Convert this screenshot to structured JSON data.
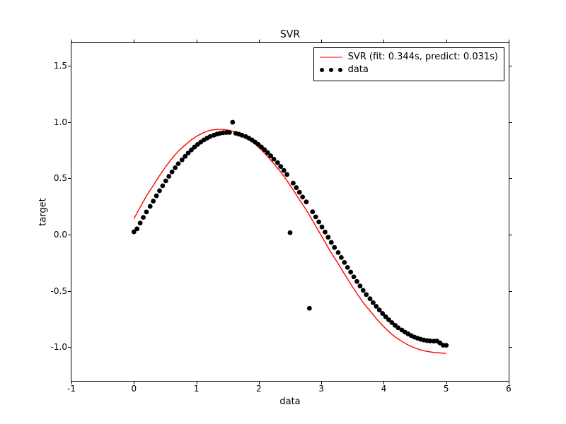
{
  "chart_data": {
    "type": "scatter",
    "title": "SVR",
    "xlabel": "data",
    "ylabel": "target",
    "xlim": [
      -1,
      6
    ],
    "ylim": [
      -1.3,
      1.7
    ],
    "xticks": [
      -1,
      0,
      1,
      2,
      3,
      4,
      5,
      6
    ],
    "yticks": [
      -1.0,
      -0.5,
      0.0,
      0.5,
      1.0,
      1.5
    ],
    "series": [
      {
        "name": "SVR (fit: 0.344s, predict: 0.031s)",
        "type": "line",
        "color": "#ff0000",
        "x": [
          0.0,
          0.1,
          0.2,
          0.31,
          0.41,
          0.51,
          0.61,
          0.71,
          0.82,
          0.92,
          1.02,
          1.12,
          1.22,
          1.33,
          1.43,
          1.53,
          1.63,
          1.73,
          1.84,
          1.94,
          2.04,
          2.14,
          2.24,
          2.35,
          2.45,
          2.55,
          2.65,
          2.76,
          2.86,
          2.96,
          3.06,
          3.16,
          3.27,
          3.37,
          3.47,
          3.57,
          3.67,
          3.78,
          3.88,
          3.98,
          4.08,
          4.18,
          4.29,
          4.39,
          4.49,
          4.59,
          4.69,
          4.8,
          4.9,
          5.0
        ],
        "y": [
          0.141,
          0.243,
          0.342,
          0.436,
          0.523,
          0.604,
          0.676,
          0.74,
          0.795,
          0.841,
          0.878,
          0.906,
          0.925,
          0.934,
          0.934,
          0.925,
          0.907,
          0.881,
          0.846,
          0.803,
          0.752,
          0.693,
          0.628,
          0.556,
          0.479,
          0.396,
          0.309,
          0.218,
          0.124,
          0.028,
          -0.068,
          -0.164,
          -0.258,
          -0.35,
          -0.439,
          -0.524,
          -0.604,
          -0.678,
          -0.746,
          -0.808,
          -0.862,
          -0.909,
          -0.949,
          -0.981,
          -1.006,
          -1.025,
          -1.038,
          -1.047,
          -1.052,
          -1.055
        ]
      },
      {
        "name": "data",
        "type": "scatter",
        "color": "#000000",
        "x": [
          0.0,
          0.05,
          0.1,
          0.15,
          0.2,
          0.26,
          0.31,
          0.36,
          0.41,
          0.46,
          0.51,
          0.56,
          0.61,
          0.66,
          0.71,
          0.77,
          0.82,
          0.87,
          0.92,
          0.97,
          1.02,
          1.07,
          1.12,
          1.17,
          1.22,
          1.28,
          1.33,
          1.38,
          1.43,
          1.48,
          1.53,
          1.58,
          1.63,
          1.68,
          1.73,
          1.79,
          1.84,
          1.89,
          1.94,
          1.99,
          2.04,
          2.09,
          2.14,
          2.19,
          2.24,
          2.3,
          2.35,
          2.4,
          2.45,
          2.5,
          2.55,
          2.6,
          2.65,
          2.7,
          2.76,
          2.81,
          2.86,
          2.91,
          2.96,
          3.01,
          3.06,
          3.11,
          3.16,
          3.21,
          3.27,
          3.32,
          3.37,
          3.42,
          3.47,
          3.52,
          3.57,
          3.62,
          3.67,
          3.72,
          3.78,
          3.83,
          3.88,
          3.93,
          3.98,
          4.03,
          4.08,
          4.13,
          4.18,
          4.23,
          4.29,
          4.34,
          4.39,
          4.44,
          4.49,
          4.54,
          4.59,
          4.64,
          4.69,
          4.74,
          4.8,
          4.85,
          4.9,
          4.95,
          5.0
        ],
        "y": [
          0.024,
          0.051,
          0.102,
          0.152,
          0.201,
          0.25,
          0.297,
          0.344,
          0.389,
          0.433,
          0.476,
          0.517,
          0.556,
          0.593,
          0.629,
          0.663,
          0.694,
          0.724,
          0.751,
          0.777,
          0.8,
          0.821,
          0.84,
          0.856,
          0.87,
          0.882,
          0.892,
          0.899,
          0.904,
          0.906,
          0.906,
          0.997,
          0.899,
          0.891,
          0.882,
          0.87,
          0.856,
          0.84,
          0.821,
          0.801,
          0.778,
          0.754,
          0.728,
          0.699,
          0.669,
          0.638,
          0.604,
          0.569,
          0.533,
          0.016,
          0.456,
          0.416,
          0.375,
          0.333,
          0.29,
          -0.655,
          0.202,
          0.157,
          0.112,
          0.067,
          0.022,
          -0.024,
          -0.07,
          -0.115,
          -0.16,
          -0.204,
          -0.248,
          -0.292,
          -0.334,
          -0.376,
          -0.417,
          -0.457,
          -0.496,
          -0.533,
          -0.57,
          -0.605,
          -0.638,
          -0.67,
          -0.701,
          -0.73,
          -0.757,
          -0.782,
          -0.806,
          -0.828,
          -0.848,
          -0.867,
          -0.883,
          -0.898,
          -0.911,
          -0.921,
          -0.93,
          -0.937,
          -0.942,
          -0.945,
          -0.947,
          -0.946,
          -0.963,
          -0.983,
          -0.984
        ]
      }
    ]
  },
  "legend": {
    "svr_label": "SVR (fit: 0.344s, predict: 0.031s)",
    "data_label": "data"
  },
  "title": "SVR",
  "xlabel": "data",
  "ylabel": "target"
}
